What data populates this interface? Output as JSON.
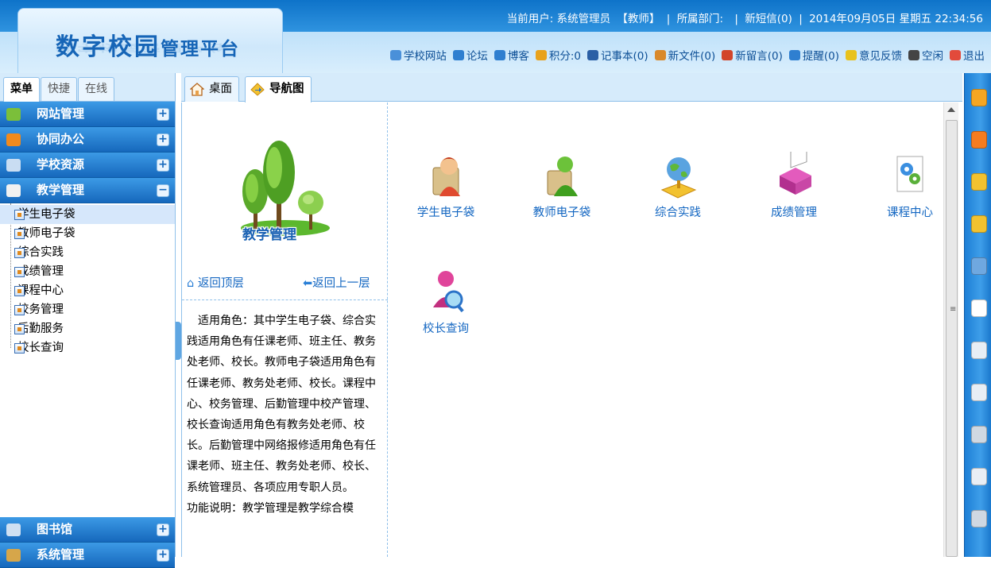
{
  "header": {
    "logo_main": "数字校园",
    "logo_sub": "管理平台",
    "status": {
      "user_label": "当前用户:",
      "user_name": "系统管理员",
      "user_role": "【教师】",
      "sep1": "|",
      "dept_label": "所属部门:",
      "sep2": "|",
      "sms": "新短信(0)",
      "sep3": "|",
      "datetime": "2014年09月05日 星期五 22:34:56"
    },
    "links": [
      {
        "label": "学校网站",
        "icon": "school-site-icon",
        "color": "#4a90d9"
      },
      {
        "label": "论坛",
        "icon": "forum-icon",
        "color": "#2f7fd0"
      },
      {
        "label": "博客",
        "icon": "blog-icon",
        "color": "#2f7fd0"
      },
      {
        "label": "积分:0",
        "icon": "points-icon",
        "color": "#e8a21c"
      },
      {
        "label": "记事本(0)",
        "icon": "notebook-icon",
        "color": "#2a5fa5"
      },
      {
        "label": "新文件(0)",
        "icon": "file-icon",
        "color": "#d9892b"
      },
      {
        "label": "新留言(0)",
        "icon": "message-icon",
        "color": "#d2452a"
      },
      {
        "label": "提醒(0)",
        "icon": "reminder-icon",
        "color": "#2f7fd0"
      },
      {
        "label": "意见反馈",
        "icon": "feedback-icon",
        "color": "#e8c21c"
      },
      {
        "label": "空闲",
        "icon": "idle-status-icon",
        "color": "#444444"
      },
      {
        "label": "退出",
        "icon": "logout-icon",
        "color": "#e24a3b"
      }
    ]
  },
  "left": {
    "tabs": [
      {
        "label": "菜单",
        "active": true
      },
      {
        "label": "快捷",
        "active": false
      },
      {
        "label": "在线",
        "active": false
      }
    ],
    "menus": [
      {
        "label": "网站管理",
        "icon": "website-icon",
        "color": "#7bbf3a",
        "toggle": "+"
      },
      {
        "label": "协同办公",
        "icon": "office-icon",
        "color": "#f08a1c",
        "toggle": "+"
      },
      {
        "label": "学校资源",
        "icon": "resource-icon",
        "color": "#c9ddf2",
        "toggle": "+"
      },
      {
        "label": "教学管理",
        "icon": "teaching-icon",
        "color": "#f1f1f1",
        "toggle": "−"
      }
    ],
    "sub_items": [
      {
        "label": "学生电子袋",
        "active": true
      },
      {
        "label": "教师电子袋",
        "active": false
      },
      {
        "label": "综合实践",
        "active": false
      },
      {
        "label": "成绩管理",
        "active": false
      },
      {
        "label": "课程中心",
        "active": false
      },
      {
        "label": "校务管理",
        "active": false
      },
      {
        "label": "后勤服务",
        "active": false
      },
      {
        "label": "校长查询",
        "active": false
      }
    ],
    "bottom_menus": [
      {
        "label": "图书馆",
        "icon": "library-icon",
        "color": "#cfe0f2",
        "toggle": "+"
      },
      {
        "label": "系统管理",
        "icon": "system-icon",
        "color": "#d6a64a",
        "toggle": "+"
      }
    ]
  },
  "center_tabs": [
    {
      "label": "桌面",
      "icon": "home-icon",
      "active": false
    },
    {
      "label": "导航图",
      "icon": "navigation-map-icon",
      "active": true
    }
  ],
  "nav": {
    "module_title": "教学管理",
    "back_top": "返回顶层",
    "back_up": "返回上一层",
    "description": "适用角色：其中学生电子袋、综合实践适用角色有任课老师、班主任、教务处老师、校长。教师电子袋适用角色有任课老师、教务处老师、校长。课程中心、校务管理、后勤管理中校产管理、校长查询适用角色有教务处老师、校长。后勤管理中网络报修适用角色有任课老师、班主任、教务处老师、校长、系统管理员、各项应用专职人员。",
    "function_intro": "功能说明：教学管理是教学综合模"
  },
  "apps": [
    {
      "label": "学生电子袋",
      "icon": "student-bag-icon"
    },
    {
      "label": "教师电子袋",
      "icon": "teacher-bag-icon"
    },
    {
      "label": "综合实践",
      "icon": "globe-practice-icon"
    },
    {
      "label": "成绩管理",
      "icon": "grade-printer-icon"
    },
    {
      "label": "课程中心",
      "icon": "course-gears-icon"
    },
    {
      "label": "校长查询",
      "icon": "principal-search-icon"
    }
  ],
  "dock_icons": [
    "books-icon",
    "eraser-icon",
    "pencil-icon",
    "key-icon",
    "user-icon",
    "document-icon",
    "download-icon",
    "printer-icon",
    "settings-icon",
    "printer-icon",
    "settings-icon"
  ]
}
